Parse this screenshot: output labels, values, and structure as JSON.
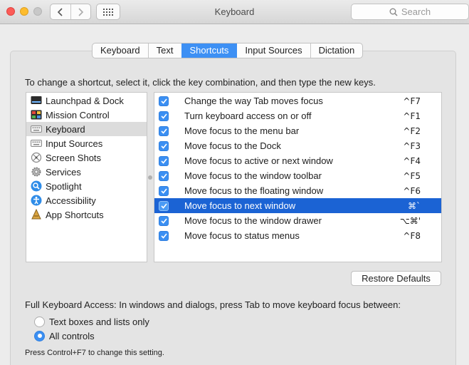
{
  "window": {
    "title": "Keyboard",
    "search_placeholder": "Search"
  },
  "tabs": [
    {
      "label": "Keyboard",
      "active": false
    },
    {
      "label": "Text",
      "active": false
    },
    {
      "label": "Shortcuts",
      "active": true
    },
    {
      "label": "Input Sources",
      "active": false
    },
    {
      "label": "Dictation",
      "active": false
    }
  ],
  "instruction": "To change a shortcut, select it, click the key combination, and then type the new keys.",
  "categories": [
    {
      "label": "Launchpad & Dock",
      "icon": "launchpad-dock-icon",
      "selected": false
    },
    {
      "label": "Mission Control",
      "icon": "mission-control-icon",
      "selected": false
    },
    {
      "label": "Keyboard",
      "icon": "keyboard-icon",
      "selected": true
    },
    {
      "label": "Input Sources",
      "icon": "input-sources-icon",
      "selected": false
    },
    {
      "label": "Screen Shots",
      "icon": "screenshot-icon",
      "selected": false
    },
    {
      "label": "Services",
      "icon": "gear-icon",
      "selected": false
    },
    {
      "label": "Spotlight",
      "icon": "spotlight-icon",
      "selected": false
    },
    {
      "label": "Accessibility",
      "icon": "accessibility-icon",
      "selected": false
    },
    {
      "label": "App Shortcuts",
      "icon": "app-shortcuts-icon",
      "selected": false
    }
  ],
  "shortcuts": [
    {
      "label": "Change the way Tab moves focus",
      "key": "^F7",
      "checked": true,
      "selected": false
    },
    {
      "label": "Turn keyboard access on or off",
      "key": "^F1",
      "checked": true,
      "selected": false
    },
    {
      "label": "Move focus to the menu bar",
      "key": "^F2",
      "checked": true,
      "selected": false
    },
    {
      "label": "Move focus to the Dock",
      "key": "^F3",
      "checked": true,
      "selected": false
    },
    {
      "label": "Move focus to active or next window",
      "key": "^F4",
      "checked": true,
      "selected": false
    },
    {
      "label": "Move focus to the window toolbar",
      "key": "^F5",
      "checked": true,
      "selected": false
    },
    {
      "label": "Move focus to the floating window",
      "key": "^F6",
      "checked": true,
      "selected": false
    },
    {
      "label": "Move focus to next window",
      "key": "⌘`",
      "checked": true,
      "selected": true
    },
    {
      "label": "Move focus to the window drawer",
      "key": "⌥⌘'",
      "checked": true,
      "selected": false
    },
    {
      "label": "Move focus to status menus",
      "key": "^F8",
      "checked": true,
      "selected": false
    }
  ],
  "restore_defaults_label": "Restore Defaults",
  "full_keyboard_access": {
    "label": "Full Keyboard Access: In windows and dialogs, press Tab to move keyboard focus between:",
    "options": [
      {
        "label": "Text boxes and lists only",
        "selected": false
      },
      {
        "label": "All controls",
        "selected": true
      }
    ],
    "hint": "Press Control+F7 to change this setting."
  },
  "colors": {
    "accent": "#3d90f4",
    "selection": "#1b63d4"
  }
}
